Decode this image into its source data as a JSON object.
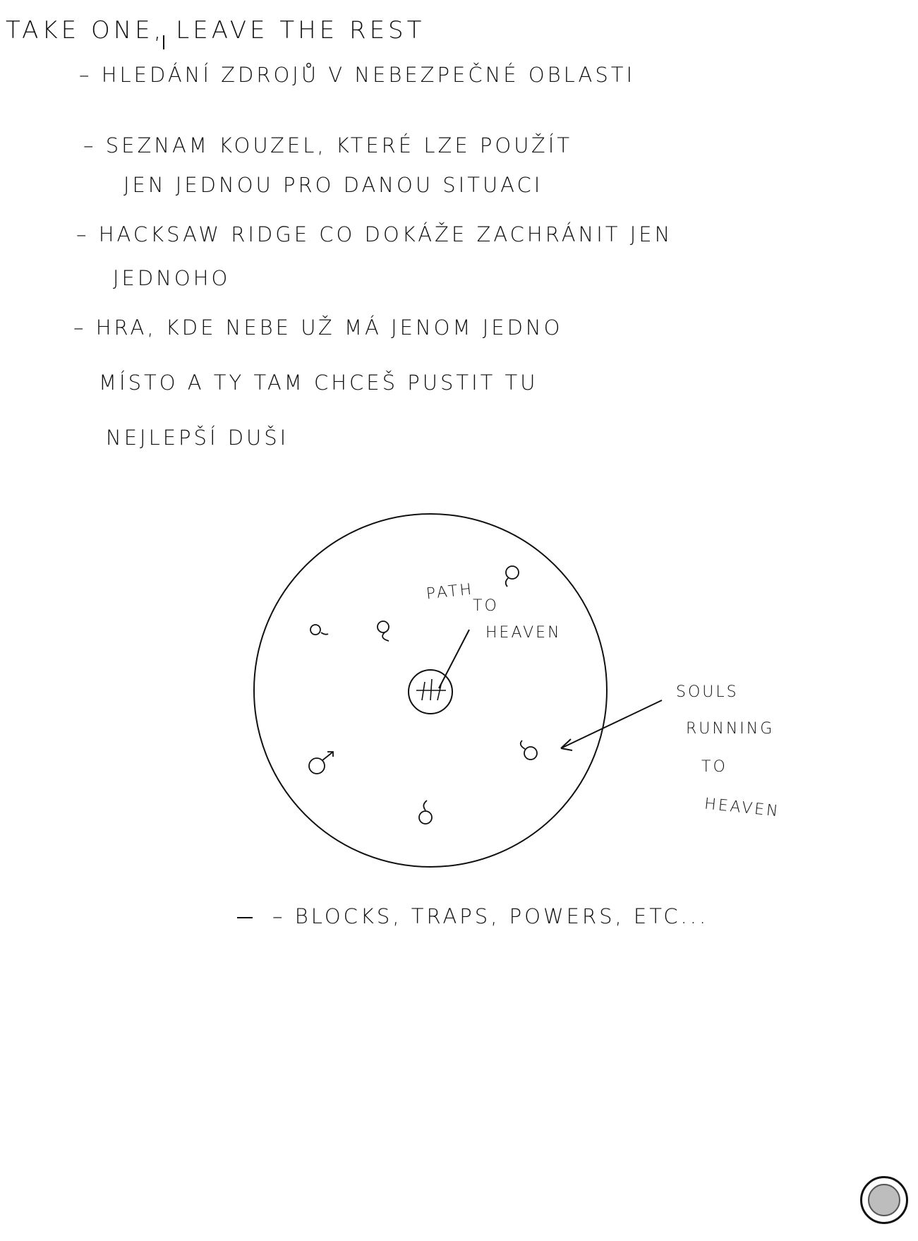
{
  "page": {
    "title": "TAKE ONE, LEAVE THE REST"
  },
  "notes": [
    "– HLEDÁNÍ ZDROJŮ V NEBEZPEČNÉ OBLASTI",
    "– SEZNAM KOUZEL, KTERÉ LZE POUŽÍT",
    "JEN JEDNOU PRO DANOU SITUACI",
    "– HACKSAW RIDGE CO DOKÁŽE ZACHRÁNIT JEN",
    "JEDNOHO",
    "– HRA, KDE NEBE UŽ MÁ JENOM JEDNO",
    "MÍSTO A TY TAM CHCEŠ PUSTIT TU",
    "NEJLEPŠÍ DUŠI"
  ],
  "diagram": {
    "path_label_1": "PATH",
    "path_label_2": "TO",
    "path_label_3": "HEAVEN",
    "souls_label_1": "SOULS",
    "souls_label_2": "RUNNING",
    "souls_label_3": "TO",
    "souls_label_4": "HEAVEN",
    "center_icon": "heaven-gate-icon",
    "soul_icons": [
      "soul-figure-icon",
      "soul-figure-icon",
      "soul-figure-icon",
      "soul-figure-icon",
      "soul-figure-icon",
      "soul-figure-icon"
    ]
  },
  "footer_note": "– BLOCKS, TRAPS, POWERS, ETC...",
  "controls": {
    "fab_icon": "record-button-icon"
  }
}
